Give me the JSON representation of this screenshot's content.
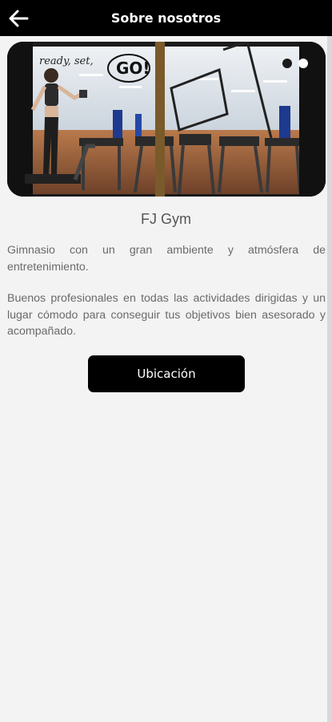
{
  "header": {
    "title": "Sobre nosotros",
    "back_icon": "arrow-left-icon"
  },
  "carousel": {
    "image_description": "gym interior with treadmills and a woman exercising, window lettering",
    "window_text": "ready, set, GO!",
    "slide_count": 2,
    "active_slide": 1
  },
  "about": {
    "gym_name": "FJ Gym",
    "paragraph_1": "Gimnasio con un gran ambiente y atmósfera de entretenimiento.",
    "paragraph_2": "Buenos profesionales en todas las actividades dirigidas y un lugar cómodo para conseguir tus objetivos bien asesorado y acompañado."
  },
  "actions": {
    "location_label": "Ubicación"
  },
  "colors": {
    "appbar": "#000000",
    "background": "#f3f3f3",
    "text": "#6a6a6a",
    "button": "#000000"
  }
}
